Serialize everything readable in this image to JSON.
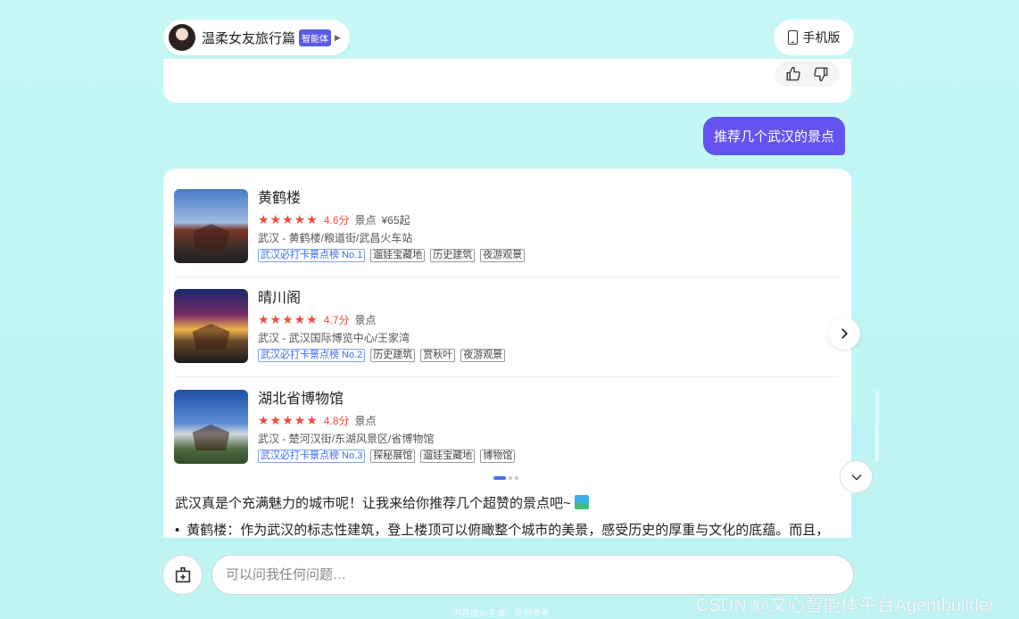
{
  "agent": {
    "name": "温柔女友旅行篇",
    "badge": "智能体"
  },
  "header": {
    "mobile_label": "手机版"
  },
  "user_message": "推荐几个武汉的景点",
  "pois": [
    {
      "name": "黄鹤楼",
      "stars": "★★★★★",
      "score": "4.6分",
      "type": "景点",
      "price": "¥65起",
      "location": "武汉 - 黄鹤楼/粮道街/武昌火车站",
      "tags": [
        "武汉必打卡景点榜 No.1",
        "遛娃宝藏地",
        "历史建筑",
        "夜游观景"
      ]
    },
    {
      "name": "晴川阁",
      "stars": "★★★★★",
      "score": "4.7分",
      "type": "景点",
      "price": "",
      "location": "武汉 - 武汉国际博览中心/王家湾",
      "tags": [
        "武汉必打卡景点榜 No.2",
        "历史建筑",
        "赏秋叶",
        "夜游观景"
      ]
    },
    {
      "name": "湖北省博物馆",
      "stars": "★★★★★",
      "score": "4.8分",
      "type": "景点",
      "price": "",
      "location": "武汉 - 楚河汉街/东湖风景区/省博物馆",
      "tags": [
        "武汉必打卡景点榜 No.3",
        "探秘展馆",
        "遛娃宝藏地",
        "博物馆"
      ]
    }
  ],
  "answer": {
    "intro": "武汉真是个充满魅力的城市呢！让我来给你推荐几个超赞的景点吧~",
    "bullet1": "黄鹤楼：作为武汉的标志性建筑，登上楼顶可以俯瞰整个城市的美景，感受历史的厚重与文化的底蕴。而且，"
  },
  "input": {
    "placeholder": "可以问我任何问题…"
  },
  "footer": {
    "disclaimer": "内容由AI生成，仅供参考",
    "watermark": "CSDN @文心智能体平台Agentbuilder"
  },
  "colors": {
    "accent": "#6453f0",
    "rating": "#f5493b",
    "rank_tag": "#3a6df0"
  }
}
